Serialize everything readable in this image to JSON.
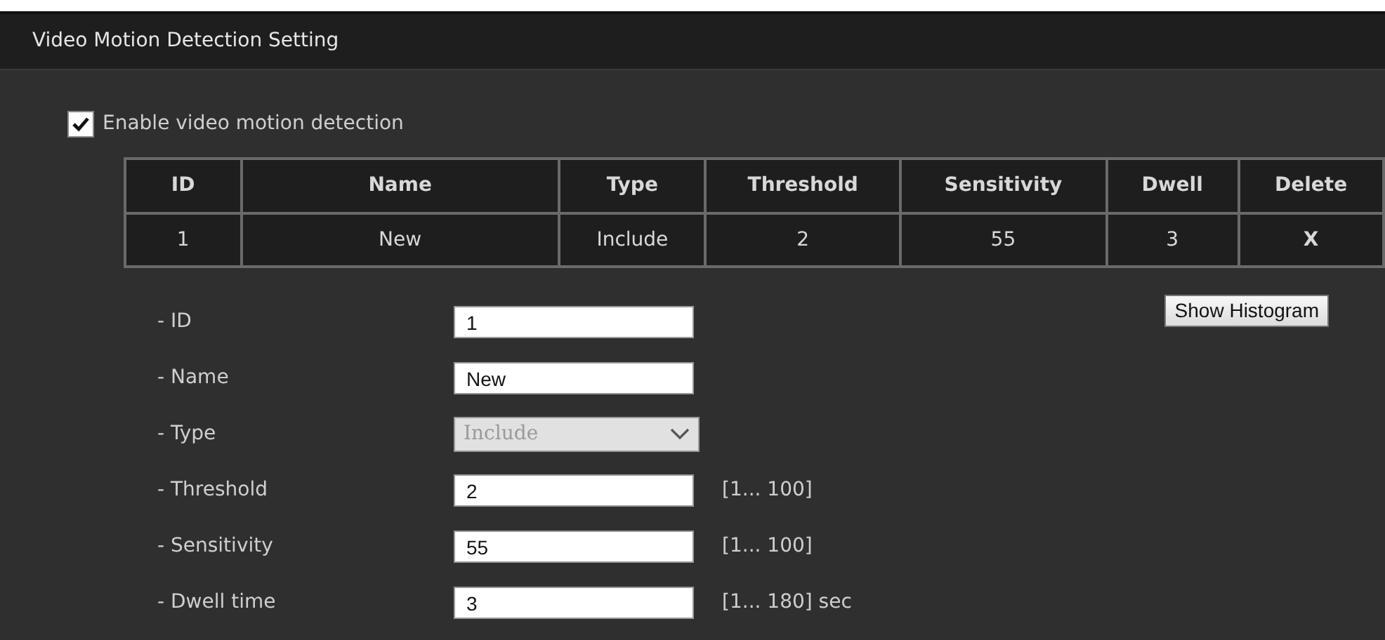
{
  "title": "Video Motion Detection Setting",
  "enable": {
    "label": "Enable video motion detection",
    "checked": true
  },
  "table": {
    "columns": [
      "ID",
      "Name",
      "Type",
      "Threshold",
      "Sensitivity",
      "Dwell",
      "Delete"
    ],
    "rows": [
      [
        "1",
        "New",
        "Include",
        "2",
        "55",
        "3",
        "X"
      ]
    ]
  },
  "form": [
    {
      "kind": "text",
      "label": "- ID",
      "value": "1"
    },
    {
      "kind": "text",
      "label": "- Name",
      "value": "New"
    },
    {
      "kind": "select",
      "label": "- Type",
      "value": "Include",
      "disabled": true
    },
    {
      "kind": "text",
      "label": "- Threshold",
      "value": "2",
      "hint": "[1... 100]"
    },
    {
      "kind": "text",
      "label": "- Sensitivity",
      "value": "55",
      "hint": "[1... 100]"
    },
    {
      "kind": "text",
      "label": "- Dwell time",
      "value": "3",
      "hint": "[1... 180] sec"
    }
  ],
  "histogram_button": "Show Histogram"
}
